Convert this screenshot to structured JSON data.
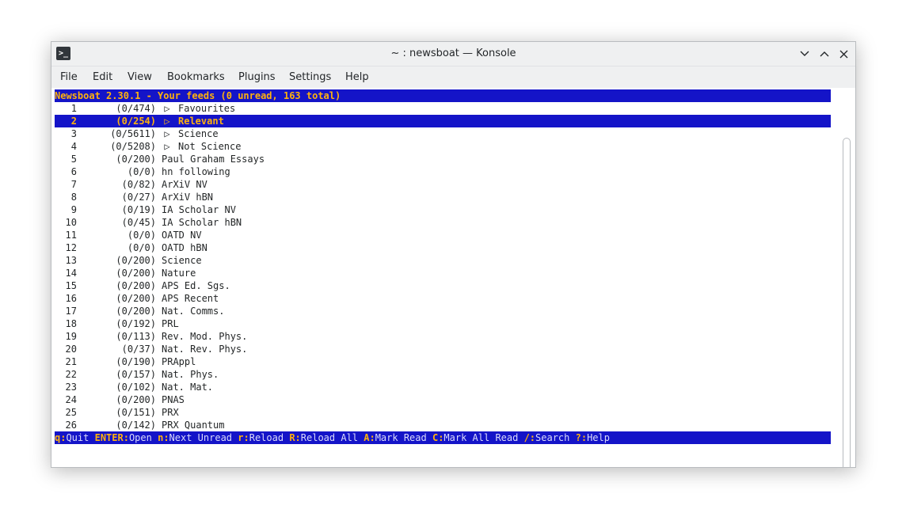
{
  "window": {
    "title": "~ : newsboat — Konsole",
    "app_icon": "terminal-icon",
    "controls": [
      "chevron-down-icon",
      "chevron-up-icon",
      "close-icon"
    ]
  },
  "menu": [
    "File",
    "Edit",
    "View",
    "Bookmarks",
    "Plugins",
    "Settings",
    "Help"
  ],
  "newsboat": {
    "header": "Newsboat 2.30.1 - Your feeds (0 unread, 163 total)",
    "selected_index": 1,
    "feeds": [
      {
        "num": "1",
        "count": "(0/474)",
        "query": true,
        "name": "Favourites"
      },
      {
        "num": "2",
        "count": "(0/254)",
        "query": true,
        "name": "Relevant"
      },
      {
        "num": "3",
        "count": "(0/5611)",
        "query": true,
        "name": "Science"
      },
      {
        "num": "4",
        "count": "(0/5208)",
        "query": true,
        "name": "Not Science"
      },
      {
        "num": "5",
        "count": "(0/200)",
        "query": false,
        "name": "Paul Graham Essays"
      },
      {
        "num": "6",
        "count": "(0/0)",
        "query": false,
        "name": "hn following"
      },
      {
        "num": "7",
        "count": "(0/82)",
        "query": false,
        "name": "ArXiV NV"
      },
      {
        "num": "8",
        "count": "(0/27)",
        "query": false,
        "name": "ArXiV hBN"
      },
      {
        "num": "9",
        "count": "(0/19)",
        "query": false,
        "name": "IA Scholar NV"
      },
      {
        "num": "10",
        "count": "(0/45)",
        "query": false,
        "name": "IA Scholar hBN"
      },
      {
        "num": "11",
        "count": "(0/0)",
        "query": false,
        "name": "OATD NV"
      },
      {
        "num": "12",
        "count": "(0/0)",
        "query": false,
        "name": "OATD hBN"
      },
      {
        "num": "13",
        "count": "(0/200)",
        "query": false,
        "name": "Science"
      },
      {
        "num": "14",
        "count": "(0/200)",
        "query": false,
        "name": "Nature"
      },
      {
        "num": "15",
        "count": "(0/200)",
        "query": false,
        "name": "APS Ed. Sgs."
      },
      {
        "num": "16",
        "count": "(0/200)",
        "query": false,
        "name": "APS Recent"
      },
      {
        "num": "17",
        "count": "(0/200)",
        "query": false,
        "name": "Nat. Comms."
      },
      {
        "num": "18",
        "count": "(0/192)",
        "query": false,
        "name": "PRL"
      },
      {
        "num": "19",
        "count": "(0/113)",
        "query": false,
        "name": "Rev. Mod. Phys."
      },
      {
        "num": "20",
        "count": "(0/37)",
        "query": false,
        "name": "Nat. Rev. Phys."
      },
      {
        "num": "21",
        "count": "(0/190)",
        "query": false,
        "name": "PRAppl"
      },
      {
        "num": "22",
        "count": "(0/157)",
        "query": false,
        "name": "Nat. Phys."
      },
      {
        "num": "23",
        "count": "(0/102)",
        "query": false,
        "name": "Nat. Mat."
      },
      {
        "num": "24",
        "count": "(0/200)",
        "query": false,
        "name": "PNAS"
      },
      {
        "num": "25",
        "count": "(0/151)",
        "query": false,
        "name": "PRX"
      },
      {
        "num": "26",
        "count": "(0/142)",
        "query": false,
        "name": "PRX Quantum"
      }
    ],
    "footer": [
      {
        "key": "q:",
        "label": "Quit"
      },
      {
        "key": "ENTER:",
        "label": "Open"
      },
      {
        "key": "n:",
        "label": "Next Unread"
      },
      {
        "key": "r:",
        "label": "Reload"
      },
      {
        "key": "R:",
        "label": "Reload All"
      },
      {
        "key": "A:",
        "label": "Mark Read"
      },
      {
        "key": "C:",
        "label": "Mark All Read"
      },
      {
        "key": "/:",
        "label": "Search"
      },
      {
        "key": "?:",
        "label": "Help"
      }
    ],
    "query_marker": "▷"
  },
  "colors": {
    "bar_bg": "#1414c8",
    "accent": "#ffb20d",
    "footer_text": "#dbdbfb",
    "text": "#232627"
  }
}
